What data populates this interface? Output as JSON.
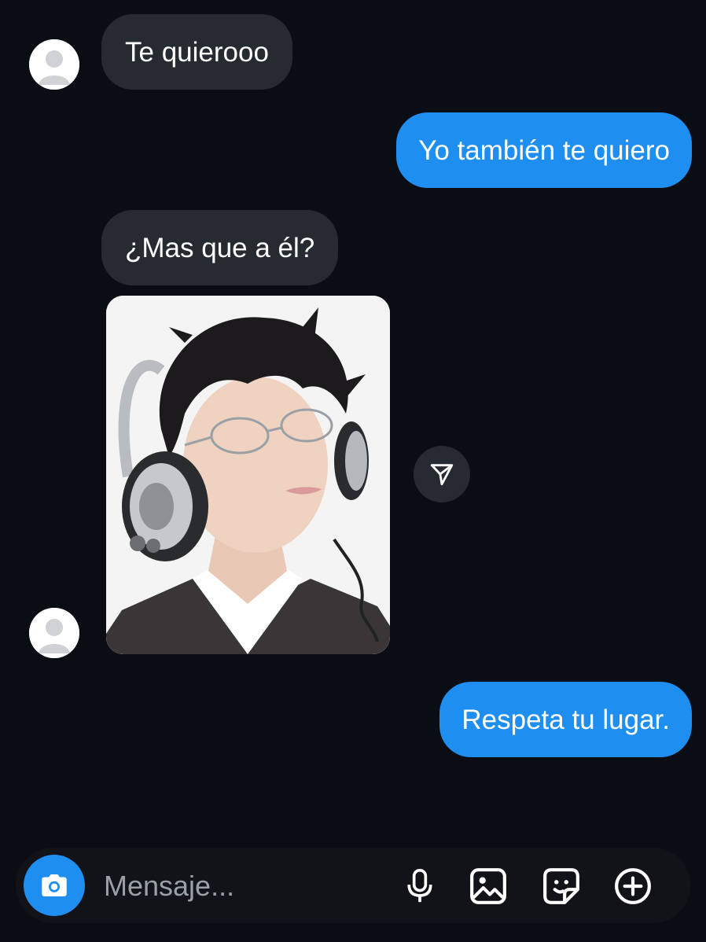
{
  "conversation": {
    "messages": [
      {
        "sender": "them",
        "text": "Te quierooo"
      },
      {
        "sender": "me",
        "text": "Yo también te quiero"
      },
      {
        "sender": "them",
        "text": "¿Mas que a él?"
      },
      {
        "sender": "them",
        "type": "photo",
        "content": "photo"
      },
      {
        "sender": "me",
        "text": "Respeta tu lugar."
      }
    ]
  },
  "composer": {
    "placeholder": "Mensaje...",
    "value": "",
    "icons": [
      "camera-icon",
      "microphone-icon",
      "gallery-icon",
      "sticker-icon",
      "plus-icon"
    ]
  },
  "colors": {
    "background": "#0b0d14",
    "incoming_bubble": "#262a31",
    "outgoing_bubble": "#1f8ef1",
    "accent": "#1f8ef1"
  }
}
